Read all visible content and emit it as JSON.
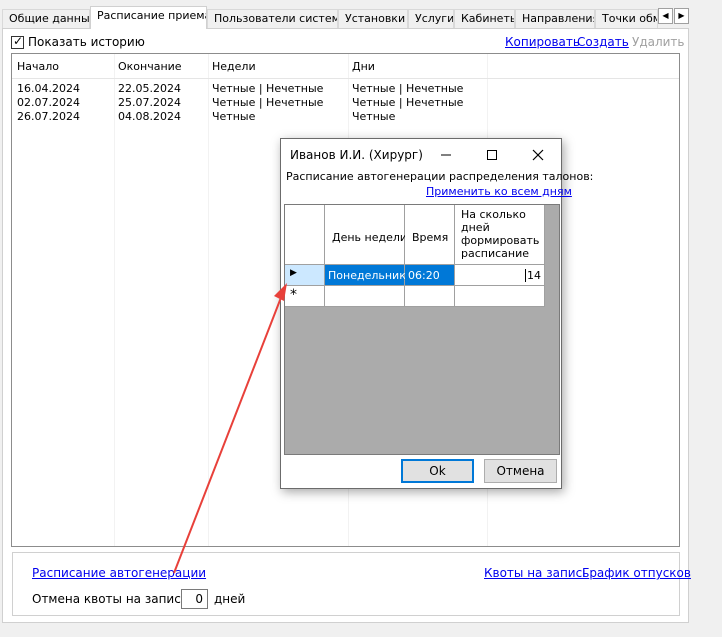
{
  "tabs": [
    {
      "label": "Общие данные",
      "active": false
    },
    {
      "label": "Расписание приема",
      "active": true
    },
    {
      "label": "Пользователи системы",
      "active": false
    },
    {
      "label": "Установки",
      "active": false
    },
    {
      "label": "Услуги",
      "active": false
    },
    {
      "label": "Кабинеты",
      "active": false
    },
    {
      "label": "Направления",
      "active": false
    },
    {
      "label": "Точки обме",
      "active": false
    }
  ],
  "toolbar": {
    "show_history_label": "Показать историю",
    "show_history_checked": true,
    "copy_label": "Копировать",
    "create_label": "Создать",
    "delete_label": "Удалить"
  },
  "history_grid": {
    "columns": [
      "Начало",
      "Окончание",
      "Недели",
      "Дни"
    ],
    "rows": [
      [
        "16.04.2024",
        "22.05.2024",
        "Четные | Нечетные",
        "Четные | Нечетные"
      ],
      [
        "02.07.2024",
        "25.07.2024",
        "Четные | Нечетные",
        "Четные | Нечетные"
      ],
      [
        "26.07.2024",
        "04.08.2024",
        "Четные",
        "Четные"
      ]
    ]
  },
  "bottom": {
    "autogen_link": "Расписание автогенерации",
    "quotas_link": "Квоты на запись",
    "vacation_link": "График отпусков",
    "cancel_quota_label": "Отмена квоты на запись за",
    "cancel_quota_value": "0",
    "days_label": "дней"
  },
  "dialog": {
    "title": "Иванов И.И. (Хирург)",
    "subtitle": "Расписание автогенерации распределения талонов:",
    "apply_all_link": "Применить ко всем дням",
    "columns": [
      "День недели",
      "Время",
      "На сколько дней формировать расписание"
    ],
    "rows": [
      {
        "day": "Понедельник",
        "time": "06:20",
        "days_ahead": "14"
      }
    ],
    "new_row_marker": "*",
    "ok_label": "Ok",
    "cancel_label": "Отмена"
  },
  "colors": {
    "selection": "#0078d7",
    "link": "#0000ee",
    "annotation_arrow": "#e8403a"
  }
}
